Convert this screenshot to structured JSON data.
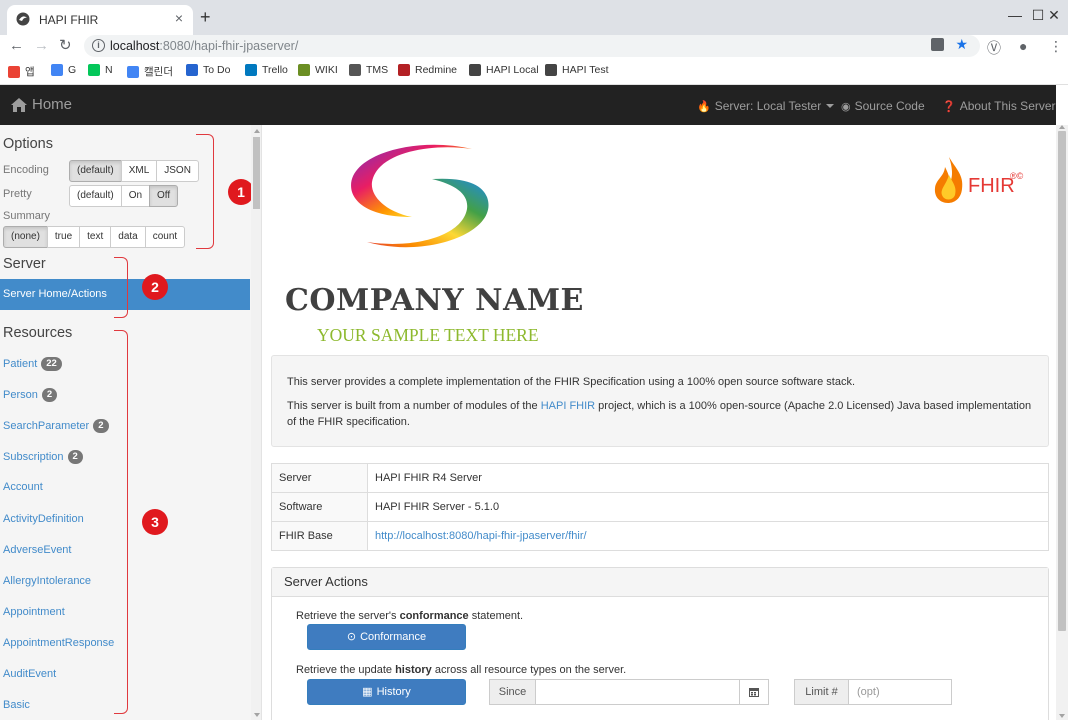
{
  "browser": {
    "tab_title": "HAPI FHIR",
    "new_tab": "+",
    "close_tab": "×",
    "url_host": "localhost",
    "url_path": ":8080/hapi-fhir-jpaserver/",
    "minimize": "—",
    "maximize": "☐",
    "close": "✕",
    "bookmarks": [
      {
        "label": "앱",
        "color": "#ea4335"
      },
      {
        "label": "G",
        "color": "#4285f4"
      },
      {
        "label": "N",
        "color": "#03c75a"
      },
      {
        "label": "캘린더",
        "color": "#4285f4"
      },
      {
        "label": "To Do",
        "color": "#2564cf"
      },
      {
        "label": "Trello",
        "color": "#0079bf"
      },
      {
        "label": "WIKI",
        "color": "#6b8e23"
      },
      {
        "label": "TMS",
        "color": "#555555"
      },
      {
        "label": "Redmine",
        "color": "#b32024"
      },
      {
        "label": "HAPI Local",
        "color": "#444444"
      },
      {
        "label": "HAPI Test",
        "color": "#444444"
      }
    ]
  },
  "navbar": {
    "brand": "Home",
    "server_menu": "Server: Local Tester",
    "source_code": "Source Code",
    "about": "About This Server"
  },
  "sidebar": {
    "options_heading": "Options",
    "encoding_label": "Encoding",
    "encoding_options": [
      "(default)",
      "XML",
      "JSON"
    ],
    "encoding_selected": "(default)",
    "pretty_label": "Pretty",
    "pretty_options": [
      "(default)",
      "On",
      "Off"
    ],
    "pretty_selected": "Off",
    "summary_label": "Summary",
    "summary_options": [
      "(none)",
      "true",
      "text",
      "data",
      "count"
    ],
    "summary_selected": "(none)",
    "server_heading": "Server",
    "server_home": "Server Home/Actions",
    "resources_heading": "Resources",
    "resources": [
      {
        "name": "Patient",
        "count": "22"
      },
      {
        "name": "Person",
        "count": "2"
      },
      {
        "name": "SearchParameter",
        "count": "2"
      },
      {
        "name": "Subscription",
        "count": "2"
      },
      {
        "name": "Account",
        "count": ""
      },
      {
        "name": "ActivityDefinition",
        "count": ""
      },
      {
        "name": "AdverseEvent",
        "count": ""
      },
      {
        "name": "AllergyIntolerance",
        "count": ""
      },
      {
        "name": "Appointment",
        "count": ""
      },
      {
        "name": "AppointmentResponse",
        "count": ""
      },
      {
        "name": "AuditEvent",
        "count": ""
      },
      {
        "name": "Basic",
        "count": ""
      }
    ]
  },
  "annotations": [
    "1",
    "2",
    "3"
  ],
  "main": {
    "company_name": "COMPANY NAME",
    "company_tagline": "YOUR SAMPLE TEXT HERE",
    "fhir_logo_text": "FHIR",
    "fhir_logo_mark": "®©",
    "intro_p1": "This server provides a complete implementation of the FHIR Specification using a 100% open source software stack.",
    "intro_p2_before": "This server is built from a number of modules of the ",
    "intro_p2_link": "HAPI FHIR",
    "intro_p2_after": " project, which is a 100% open-source (Apache 2.0 Licensed) Java based implementation of the FHIR specification.",
    "info_rows": [
      {
        "key": "Server",
        "value": "HAPI FHIR R4 Server",
        "link": false
      },
      {
        "key": "Software",
        "value": "HAPI FHIR Server - 5.1.0",
        "link": false
      },
      {
        "key": "FHIR Base",
        "value": "http://localhost:8080/hapi-fhir-jpaserver/fhir/",
        "link": true
      }
    ],
    "actions_heading": "Server Actions",
    "conformance_text_before": "Retrieve the server's ",
    "conformance_text_bold": "conformance",
    "conformance_text_after": " statement.",
    "conformance_button": "Conformance",
    "history_text_before": "Retrieve the update ",
    "history_text_bold": "history",
    "history_text_after": " across all resource types on the server.",
    "history_button": "History",
    "since_label": "Since",
    "limit_label": "Limit #",
    "limit_placeholder": "(opt)"
  },
  "colors": {
    "primary": "#428bca",
    "navbar": "#222222",
    "annotation": "#e0191e",
    "tagline": "#8db92e"
  }
}
